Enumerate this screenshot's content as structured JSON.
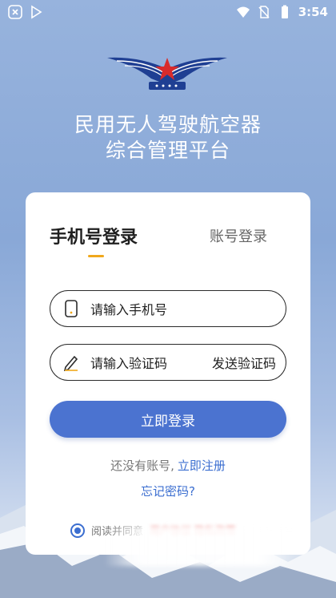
{
  "status_bar": {
    "time": "3:54",
    "icons": [
      "close-notification-icon",
      "play-store-icon",
      "wifi-icon",
      "no-sim-icon",
      "battery-icon"
    ]
  },
  "app": {
    "title_line1": "民用无人驾驶航空器",
    "title_line2": "综合管理平台",
    "logo": "civil-aviation-wings-logo"
  },
  "tabs": {
    "active": "手机号登录",
    "inactive": "账号登录",
    "indicator_color": "#f0a81c"
  },
  "form": {
    "phone_placeholder": "请输入手机号",
    "code_placeholder": "请输入验证码",
    "send_code_label": "发送验证码",
    "login_label": "立即登录",
    "no_account_text": "还没有账号,",
    "register_link": "立即注册",
    "forgot_password": "忘记密码?",
    "agreement_prefix": "阅读并同意",
    "agreement_links": "用户协议 隐私政策"
  },
  "colors": {
    "primary": "#4b73d0",
    "link": "#3b6ed0",
    "accent": "#f0a81c"
  }
}
